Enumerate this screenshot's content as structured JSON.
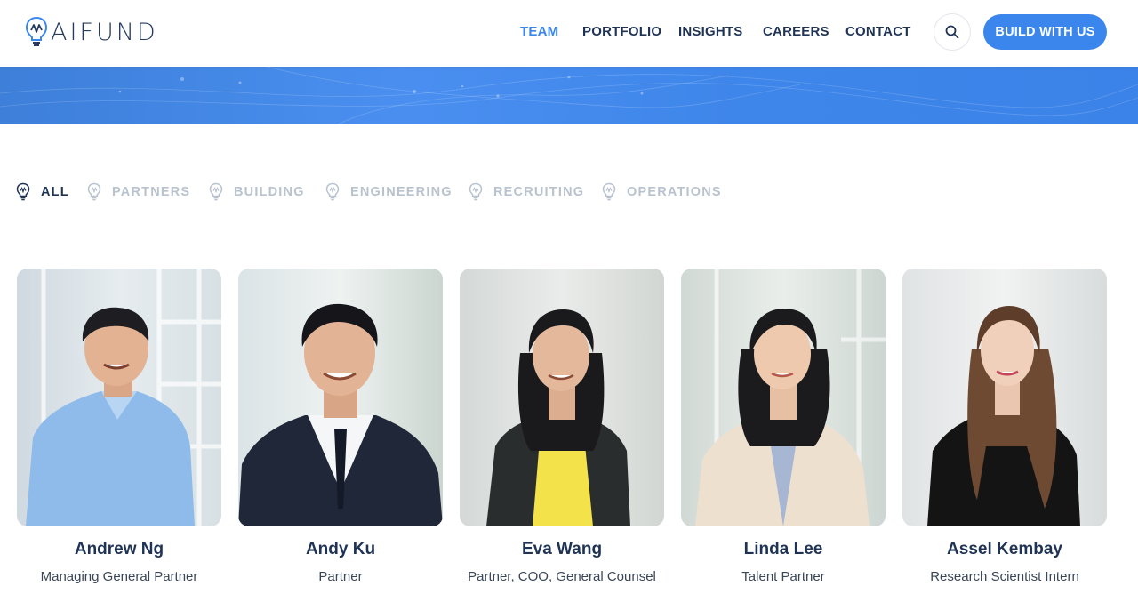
{
  "brand": {
    "logo_text": "AIFUND"
  },
  "nav": {
    "items": [
      {
        "label": "TEAM",
        "active": true
      },
      {
        "label": "PORTFOLIO",
        "active": false
      },
      {
        "label": "INSIGHTS",
        "active": false
      },
      {
        "label": "CAREERS",
        "active": false
      },
      {
        "label": "CONTACT",
        "active": false
      }
    ],
    "search_icon": "search-icon",
    "cta_label": "BUILD WITH US"
  },
  "filters": [
    {
      "label": "ALL",
      "active": true
    },
    {
      "label": "PARTNERS",
      "active": false
    },
    {
      "label": "BUILDING",
      "active": false
    },
    {
      "label": "ENGINEERING",
      "active": false
    },
    {
      "label": "RECRUITING",
      "active": false
    },
    {
      "label": "OPERATIONS",
      "active": false
    }
  ],
  "team": [
    {
      "name": "Andrew Ng",
      "role": "Managing General Partner"
    },
    {
      "name": "Andy Ku",
      "role": "Partner"
    },
    {
      "name": "Eva Wang",
      "role": "Partner, COO, General Counsel"
    },
    {
      "name": "Linda Lee",
      "role": "Talent Partner"
    },
    {
      "name": "Assel Kembay",
      "role": "Research Scientist Intern"
    }
  ],
  "colors": {
    "accent": "#3b86ec",
    "nav_text": "#1f3355",
    "filter_inactive": "#b9c3cf"
  }
}
